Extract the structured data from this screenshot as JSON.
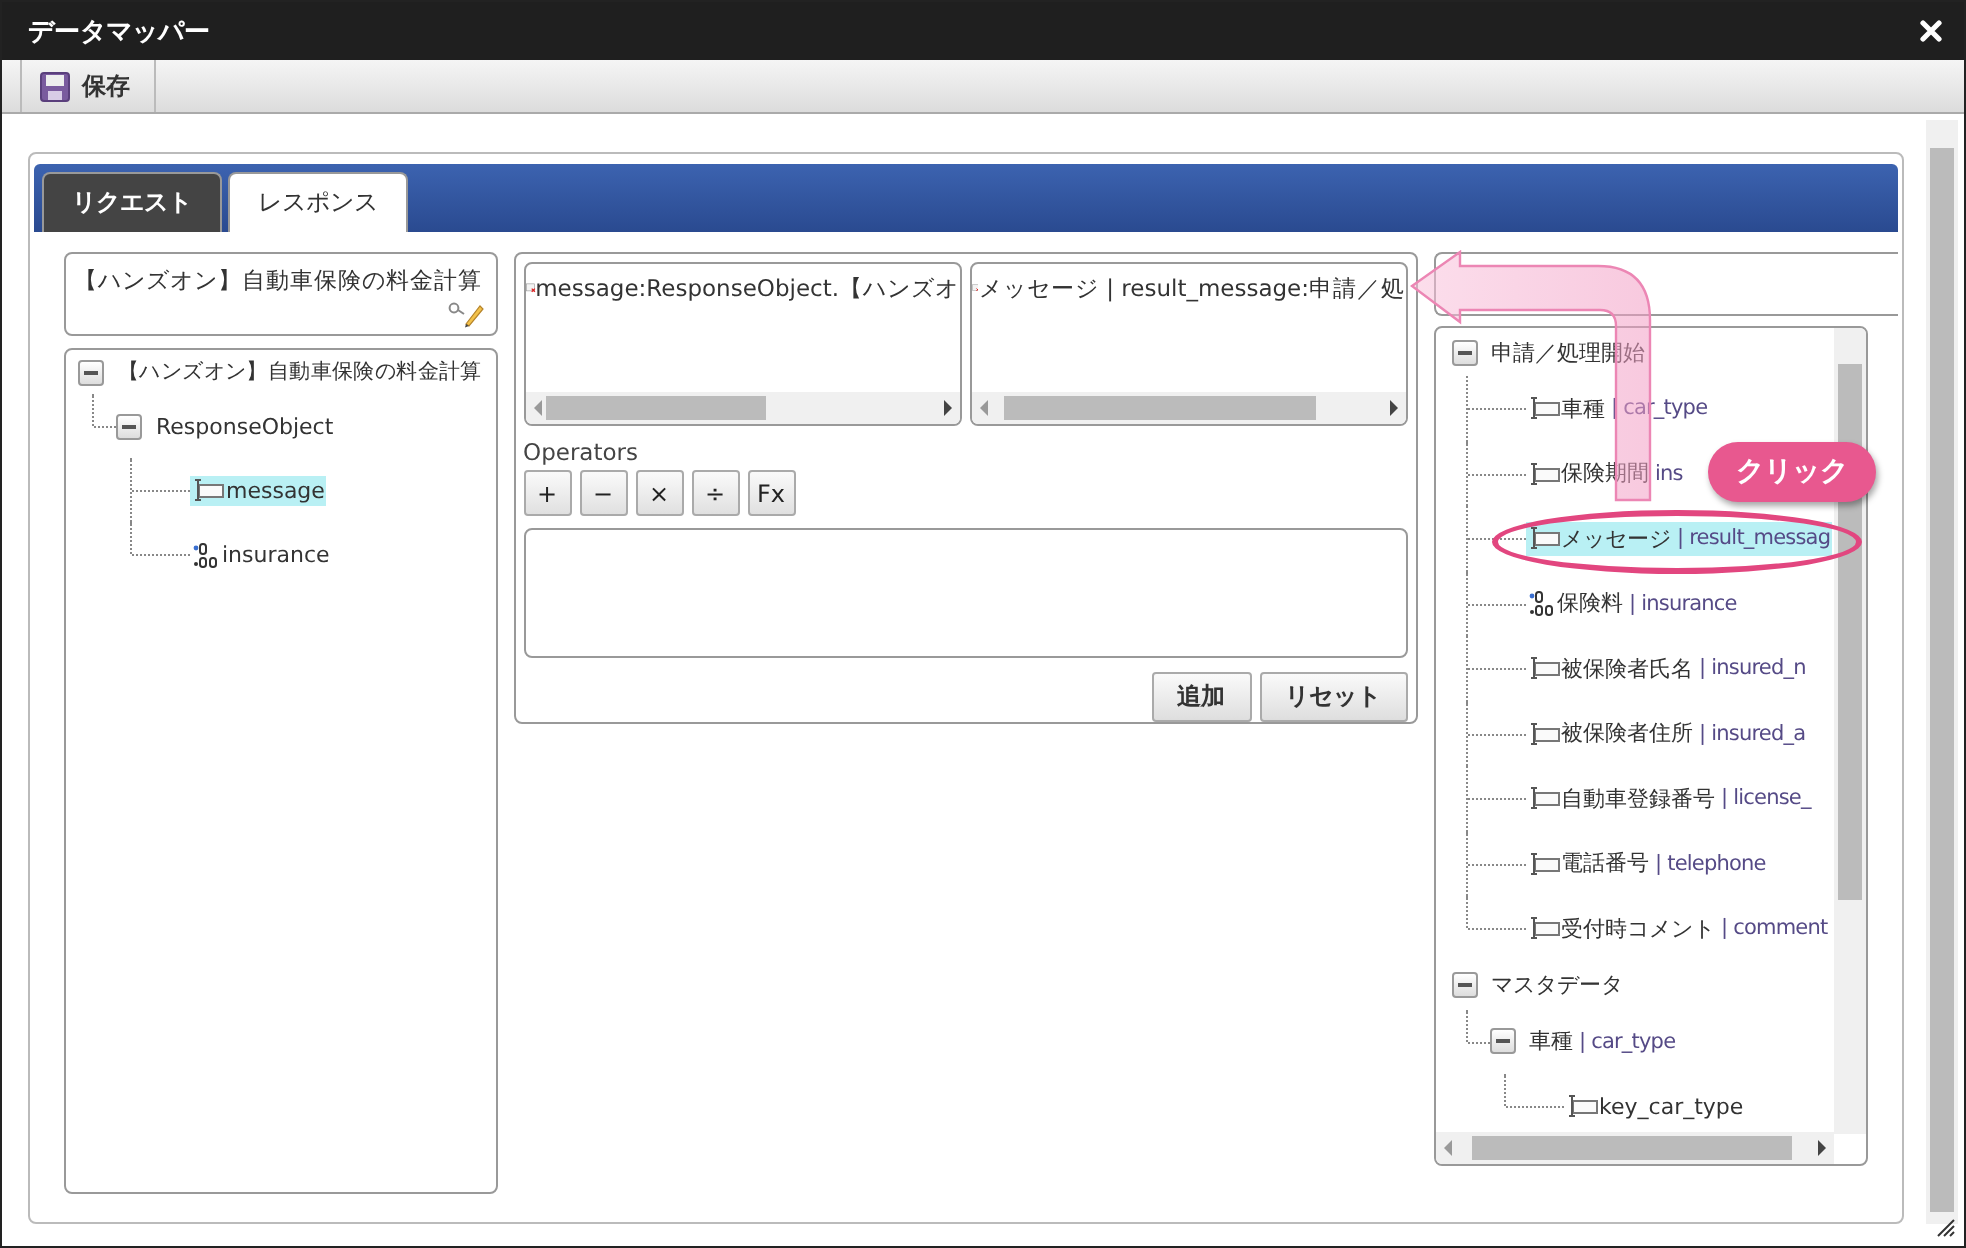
{
  "window": {
    "title": "データマッパー"
  },
  "toolbar": {
    "save": "保存"
  },
  "tabs": [
    {
      "label": "リクエスト",
      "selected": false
    },
    {
      "label": "レスポンス",
      "selected": true
    }
  ],
  "left": {
    "title": "【ハンズオン】自動車保険の料金計算",
    "tree": [
      {
        "label": "【ハンズオン】自動車保険の料金計算",
        "expanded": true,
        "children": [
          {
            "label": "ResponseObject",
            "expanded": true,
            "children": [
              {
                "label": "message",
                "kind": "string",
                "selected": true
              },
              {
                "label": "insurance",
                "kind": "number",
                "selected": false
              }
            ]
          }
        ]
      }
    ]
  },
  "mapping": {
    "source": "message:ResponseObject.【ハンズオ",
    "target": "メッセージ | result_message:申請／処",
    "operators_label": "Operators",
    "operators": [
      "+",
      "−",
      "×",
      "÷",
      "Fx"
    ],
    "buttons": [
      "追加",
      "リセット"
    ]
  },
  "right": {
    "tree": [
      {
        "label": "申請／処理開始",
        "expanded": true,
        "children": [
          {
            "label": "車種",
            "field": "| car_type",
            "kind": "string",
            "selected": false
          },
          {
            "label": "保険期間",
            "field": "ins",
            "kind": "string",
            "selected": false
          },
          {
            "label": "メッセージ",
            "field": "| result_messag",
            "kind": "string",
            "selected": true
          },
          {
            "label": "保険料",
            "field": "| insurance",
            "kind": "number",
            "selected": false
          },
          {
            "label": "被保険者氏名",
            "field": "| insured_n",
            "kind": "string",
            "selected": false
          },
          {
            "label": "被保険者住所",
            "field": "| insured_a",
            "kind": "string",
            "selected": false
          },
          {
            "label": "自動車登録番号",
            "field": "| license_",
            "kind": "string",
            "selected": false
          },
          {
            "label": "電話番号",
            "field": "| telephone",
            "kind": "string",
            "selected": false
          },
          {
            "label": "受付時コメント",
            "field": "| comment",
            "kind": "string",
            "selected": false
          }
        ]
      },
      {
        "label": "マスタデータ",
        "expanded": true,
        "children": [
          {
            "label": "車種",
            "field": "| car_type",
            "expanded": true,
            "children": [
              {
                "label": "key_car_type",
                "kind": "string",
                "selected": false
              }
            ]
          }
        ]
      }
    ]
  },
  "annotation": {
    "callout": "クリック"
  }
}
